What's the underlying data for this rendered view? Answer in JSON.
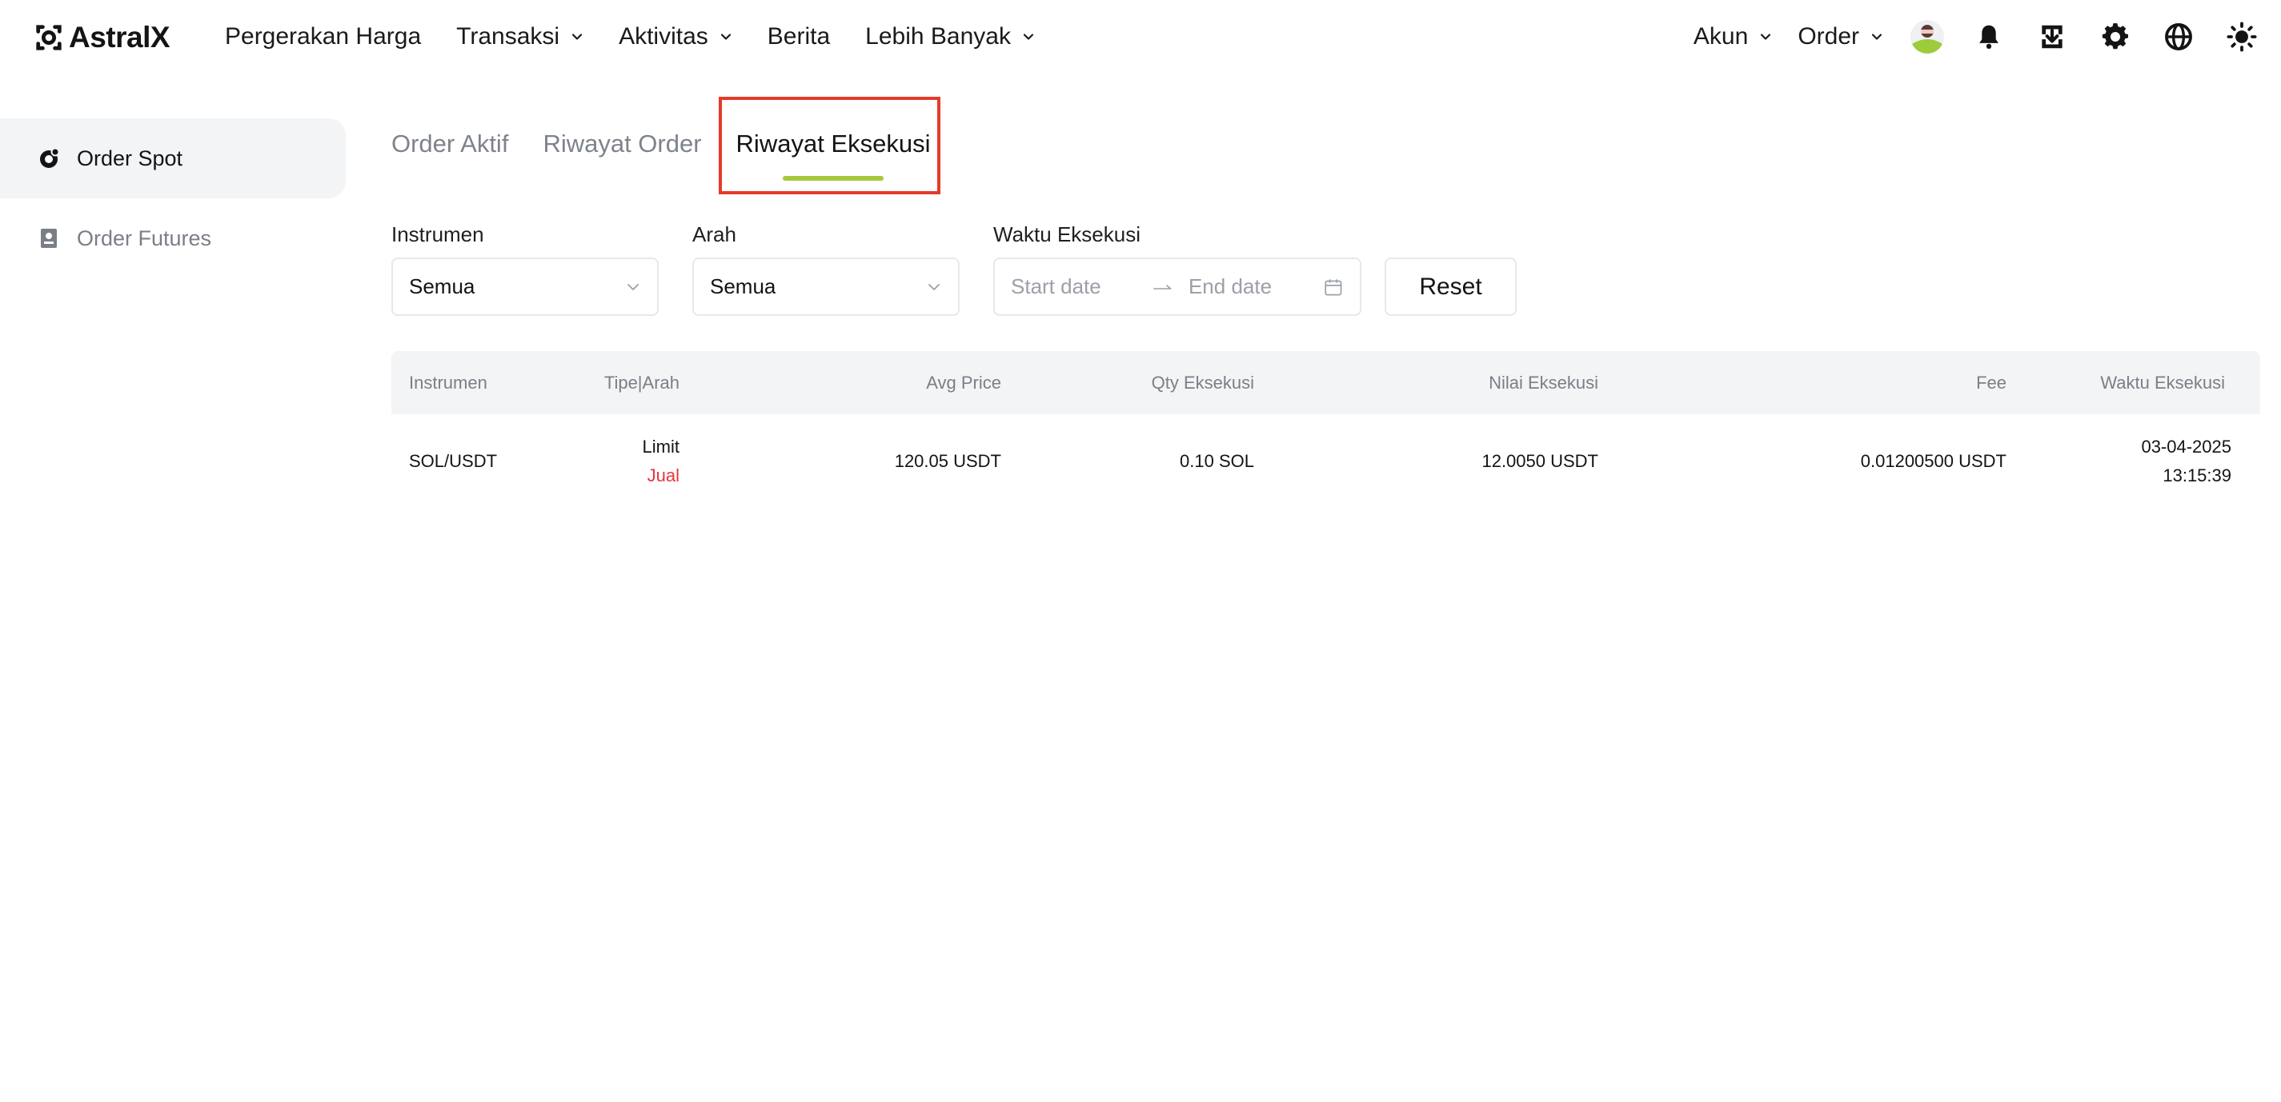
{
  "brand": {
    "name": "AstralX"
  },
  "nav": {
    "items": [
      {
        "label": "Pergerakan Harga",
        "dropdown": false
      },
      {
        "label": "Transaksi",
        "dropdown": true
      },
      {
        "label": "Aktivitas",
        "dropdown": true
      },
      {
        "label": "Berita",
        "dropdown": false
      },
      {
        "label": "Lebih Banyak",
        "dropdown": true
      }
    ],
    "right": [
      {
        "label": "Akun",
        "dropdown": true
      },
      {
        "label": "Order",
        "dropdown": true
      }
    ],
    "icons": [
      "avatar",
      "bell-icon",
      "download-icon",
      "gear-icon",
      "globe-icon",
      "sun-icon"
    ]
  },
  "sidebar": {
    "items": [
      {
        "label": "Order Spot",
        "icon": "spot-order-icon",
        "active": true
      },
      {
        "label": "Order Futures",
        "icon": "futures-order-icon",
        "active": false
      }
    ]
  },
  "tabs": [
    {
      "label": "Order Aktif",
      "active": false
    },
    {
      "label": "Riwayat Order",
      "active": false
    },
    {
      "label": "Riwayat Eksekusi",
      "active": true
    }
  ],
  "filters": {
    "instrument": {
      "label": "Instrumen",
      "value": "Semua"
    },
    "direction": {
      "label": "Arah",
      "value": "Semua"
    },
    "exec_time": {
      "label": "Waktu Eksekusi",
      "start_placeholder": "Start date",
      "end_placeholder": "End date"
    },
    "reset_label": "Reset"
  },
  "table": {
    "columns": [
      "Instrumen",
      "Tipe|Arah",
      "Avg Price",
      "Qty Eksekusi",
      "Nilai Eksekusi",
      "Fee",
      "Waktu Eksekusi"
    ],
    "rows": [
      {
        "instrument": "SOL/USDT",
        "type": "Limit",
        "side": "Jual",
        "avg_price": "120.05 USDT",
        "qty": "0.10 SOL",
        "value": "12.0050 USDT",
        "fee": "0.01200500 USDT",
        "date": "03-04-2025",
        "time": "13:15:39"
      }
    ]
  },
  "colors": {
    "accent": "#a6c83a",
    "highlight": "#e53b2a",
    "sell": "#e5343d",
    "header_bg": "#f3f4f6"
  }
}
